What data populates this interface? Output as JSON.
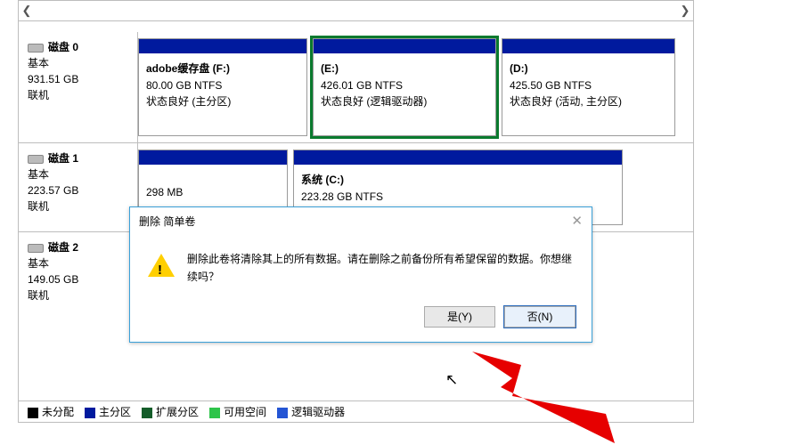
{
  "disks": [
    {
      "name": "磁盘 0",
      "type": "基本",
      "size": "931.51 GB",
      "status": "联机"
    },
    {
      "name": "磁盘 1",
      "type": "基本",
      "size": "223.57 GB",
      "status": "联机"
    },
    {
      "name": "磁盘 2",
      "type": "基本",
      "size": "149.05 GB",
      "status": "联机"
    }
  ],
  "vol_d0": [
    {
      "label": "adobe缓存盘  (F:)",
      "line2": "80.00 GB NTFS",
      "line3": "状态良好 (主分区)"
    },
    {
      "label": " (E:)",
      "line2": "426.01 GB NTFS",
      "line3": "状态良好 (逻辑驱动器)"
    },
    {
      "label": " (D:)",
      "line2": "425.50 GB NTFS",
      "line3": "状态良好 (活动, 主分区)"
    }
  ],
  "vol_d1": [
    {
      "label": "",
      "line2": "298 MB",
      "line3": ""
    },
    {
      "label": "系统  (C:)",
      "line2": "223.28 GB NTFS",
      "line3": ""
    }
  ],
  "legend": {
    "unalloc": "未分配",
    "primary": "主分区",
    "extended": "扩展分区",
    "free": "可用空间",
    "logical": "逻辑驱动器"
  },
  "dialog": {
    "title": "删除 简单卷",
    "message": "删除此卷将清除其上的所有数据。请在删除之前备份所有希望保留的数据。你想继续吗？",
    "yes": "是(Y)",
    "no": "否(N)"
  }
}
